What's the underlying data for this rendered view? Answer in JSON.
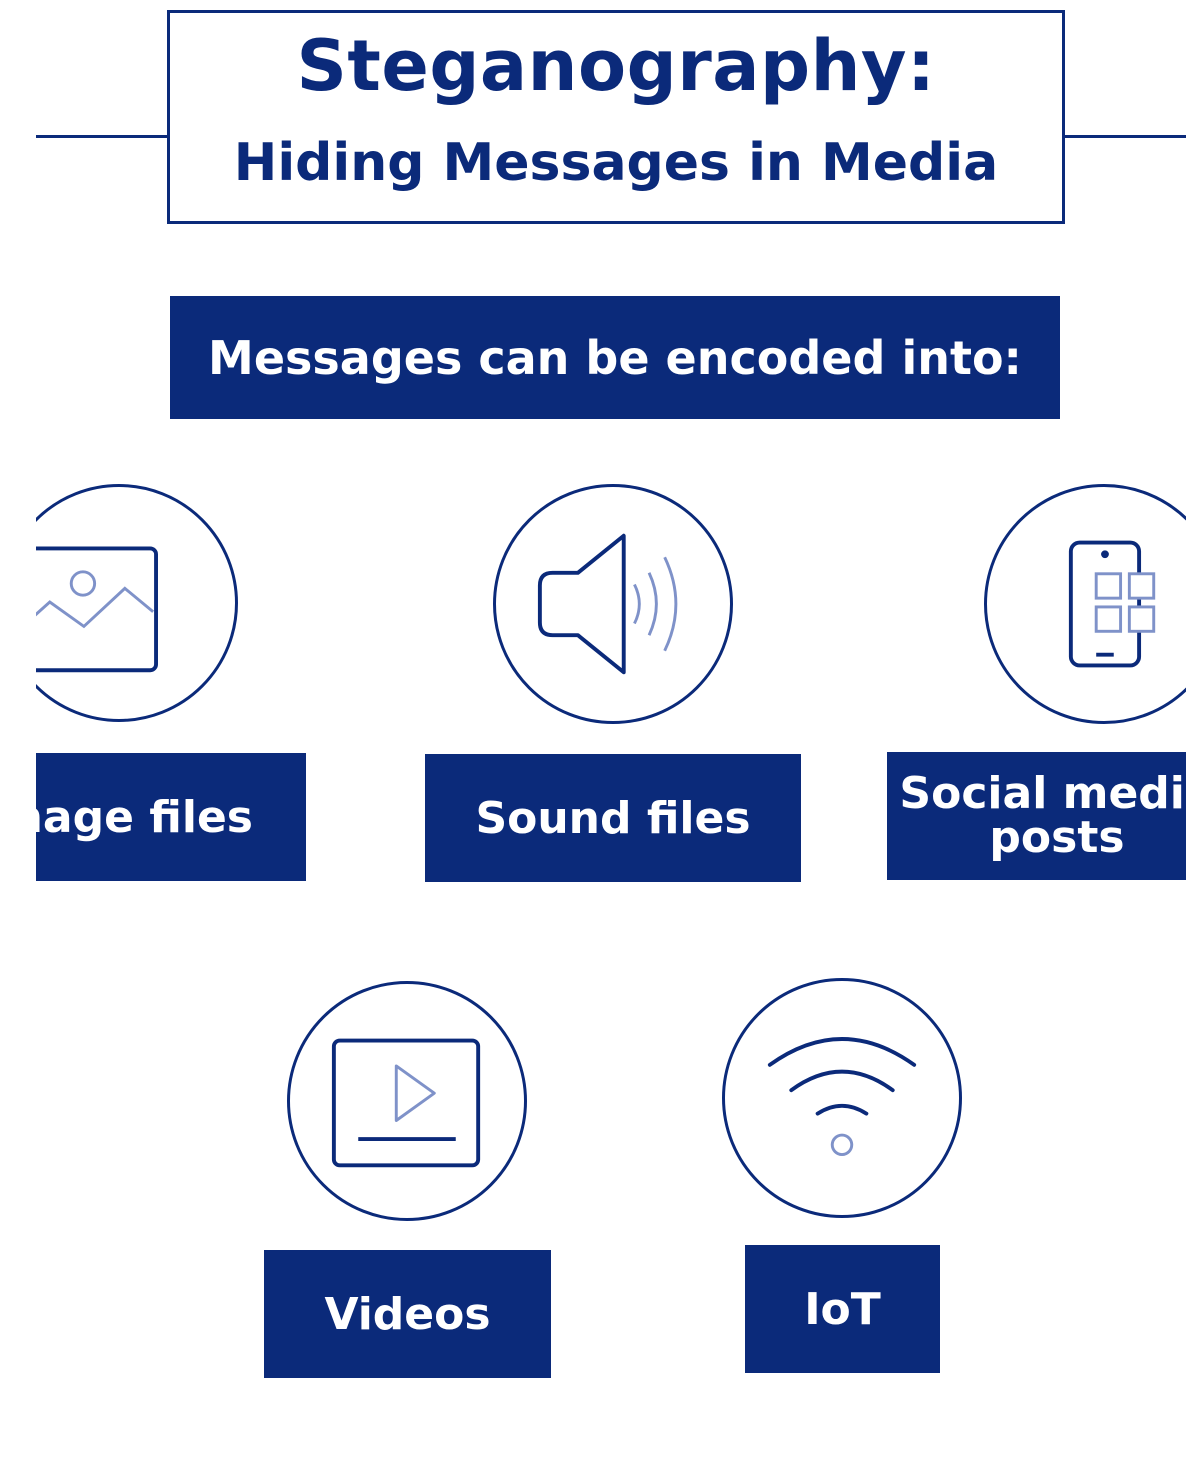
{
  "title": {
    "main": "Steganography:",
    "sub": "Hiding Messages in Media"
  },
  "banner": "Messages can be encoded into:",
  "items": [
    {
      "label": "Image files",
      "icon": "image-icon"
    },
    {
      "label": "Sound files",
      "icon": "speaker-icon"
    },
    {
      "label_line1": "Social media",
      "label_line2": "posts",
      "icon": "smartphone-apps-icon"
    },
    {
      "label": "Videos",
      "icon": "video-play-icon"
    },
    {
      "label": "IoT",
      "icon": "wifi-icon"
    }
  ],
  "colors": {
    "primary": "#0b2a7a",
    "accent": "#7f92c9",
    "background": "#ffffff"
  }
}
